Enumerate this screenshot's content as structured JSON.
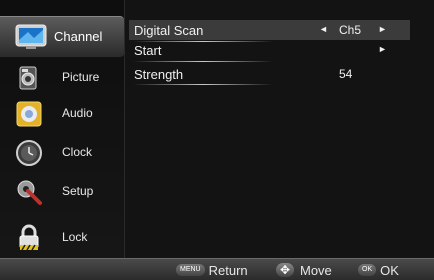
{
  "sidebar": {
    "items": [
      {
        "label": "Channel",
        "icon": "tv-icon",
        "active": true
      },
      {
        "label": "Picture",
        "icon": "camera-icon"
      },
      {
        "label": "Audio",
        "icon": "audio-icon"
      },
      {
        "label": "Clock",
        "icon": "clock-icon"
      },
      {
        "label": "Setup",
        "icon": "setup-tools-icon"
      },
      {
        "label": "Lock",
        "icon": "lock-icon"
      }
    ]
  },
  "menu": {
    "rows": [
      {
        "label": "Digital Scan",
        "value": "Ch5",
        "left_arrow": "◄",
        "right_arrow": "►",
        "selected": true
      },
      {
        "label": "Start",
        "value": "",
        "right_arrow": "►"
      },
      {
        "label": "Strength",
        "value": "54"
      }
    ]
  },
  "footer": {
    "return_badge": "MENU",
    "return_label": "Return",
    "move_badge": "✥",
    "move_label": "Move",
    "ok_badge": "OK",
    "ok_label": "OK"
  }
}
